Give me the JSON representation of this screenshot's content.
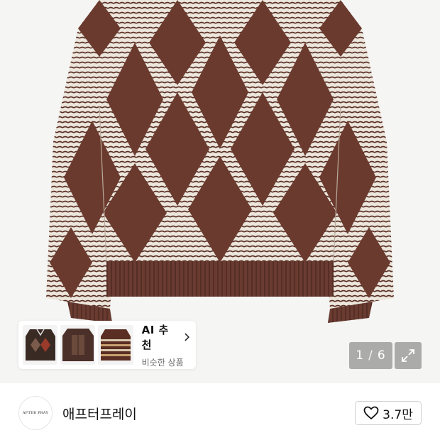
{
  "gallery": {
    "current_page": "1",
    "separator": "/",
    "total_pages": "6"
  },
  "ai_recommend": {
    "title": "AI 추천",
    "subtitle": "비슷한 상품"
  },
  "brand": {
    "name": "애프터프레이",
    "logo_text": "AFTER PRAY"
  },
  "like": {
    "count": "3.7만"
  },
  "icons": {
    "chevron": "chevron-right-icon",
    "expand": "expand-arrows-icon",
    "like": "heart-outline-icon"
  },
  "colors": {
    "sweater_brown": "#6b3a2e",
    "sweater_cream": "#ede8e0",
    "overlay": "#6e6e6e"
  }
}
